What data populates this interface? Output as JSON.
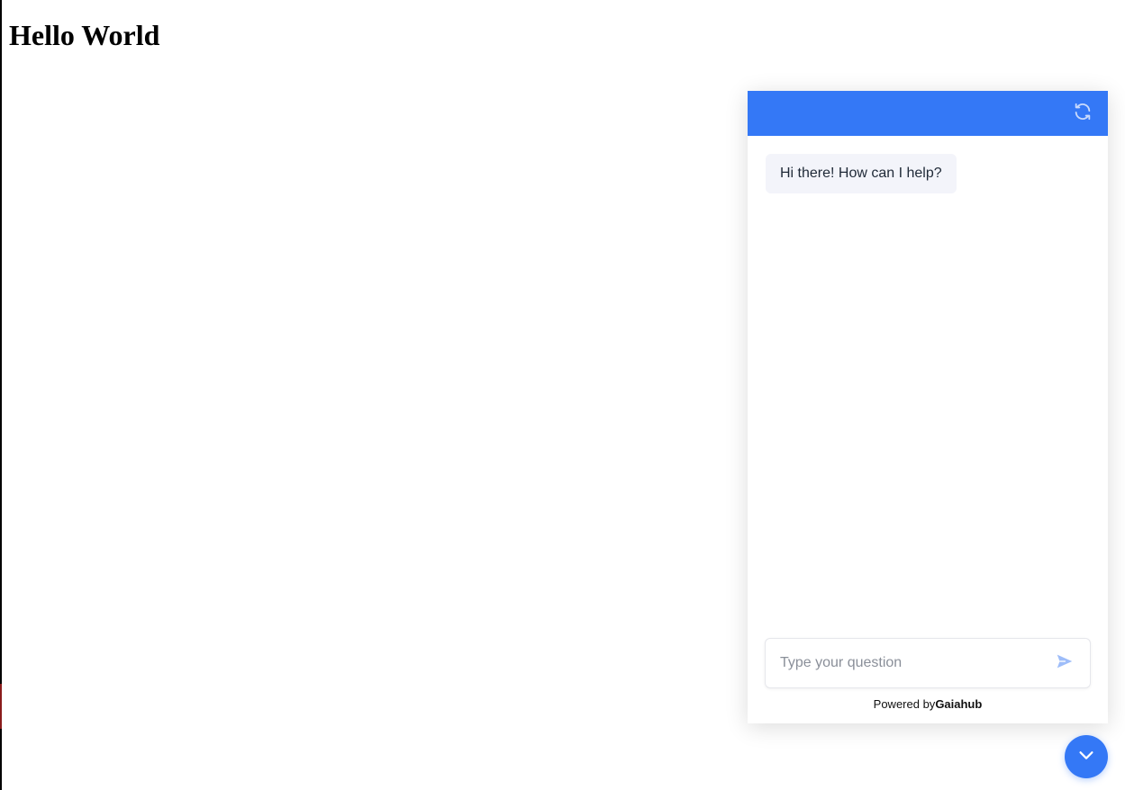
{
  "page": {
    "heading": "Hello World"
  },
  "chat": {
    "header": {
      "refresh_icon": "refresh-icon",
      "color": "#3478f6"
    },
    "messages": [
      {
        "from": "bot",
        "text": "Hi there! How can I help?"
      }
    ],
    "input": {
      "placeholder": "Type your question",
      "value": ""
    },
    "send_icon": "send-icon",
    "powered_by": {
      "prefix": "Powered by",
      "brand": "Gaiahub"
    },
    "toggle_icon": "chevron-down-icon"
  },
  "colors": {
    "accent": "#3478f6",
    "bubble_bg": "#f3f4fa"
  }
}
